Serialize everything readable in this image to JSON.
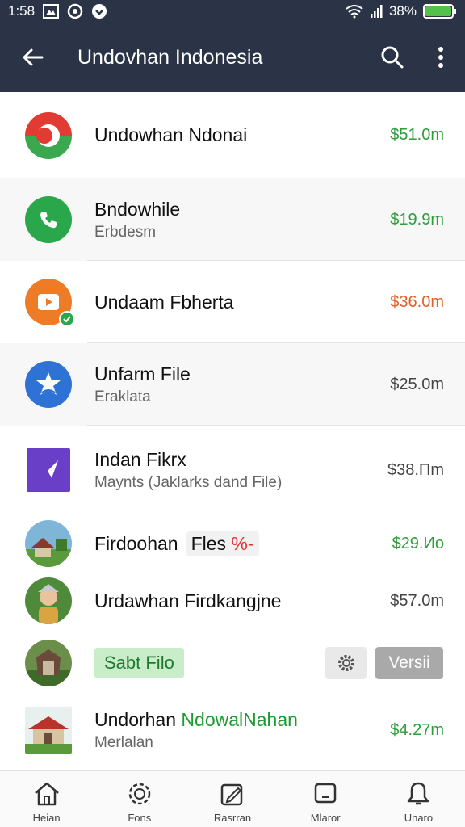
{
  "status": {
    "time": "1:58",
    "battery": "38%"
  },
  "header": {
    "title": "Undovhan Indonesia"
  },
  "items": [
    {
      "title": "Undowhan Ndonai",
      "amount": "$51.0m",
      "amount_color": "#2e9d3a"
    },
    {
      "title": "Bndowhile",
      "subtitle": "Erbdesm",
      "amount": "$19.9m",
      "amount_color": "#2e9d3a"
    },
    {
      "title": "Undaam Fbherta",
      "amount": "$36.0m",
      "amount_color": "#e0622a"
    },
    {
      "title": "Unfarm File",
      "subtitle": "Eraklata",
      "amount": "$25.0m",
      "amount_color": "#444444"
    },
    {
      "title": "Indan Fikrx",
      "subtitle": "Maynts (Jaklarks dand File)",
      "amount": "$38.Πm",
      "amount_color": "#444444"
    },
    {
      "title": "Firdoohan",
      "chip": "Fles",
      "chip_red": "%-",
      "amount": "$29.Ио",
      "amount_color": "#2e9d3a"
    },
    {
      "title": "Urdawhan  Firdkangjne",
      "amount": "$57.0m",
      "amount_color": "#444444"
    },
    {
      "chip_green": "Sabt Filo",
      "action_label": "Versii"
    },
    {
      "title": "Undorhan",
      "title_green": "NdowalNahan",
      "subtitle": "Merlalan",
      "amount": "$4.27m",
      "amount_color": "#2e9d3a"
    }
  ],
  "nav": [
    {
      "label": "Heian",
      "icon": "home-icon"
    },
    {
      "label": "Fons",
      "icon": "gear-icon"
    },
    {
      "label": "Rasrran",
      "icon": "edit-icon"
    },
    {
      "label": "Mlaror",
      "icon": "chat-icon"
    },
    {
      "label": "Unaro",
      "icon": "bell-icon"
    }
  ]
}
